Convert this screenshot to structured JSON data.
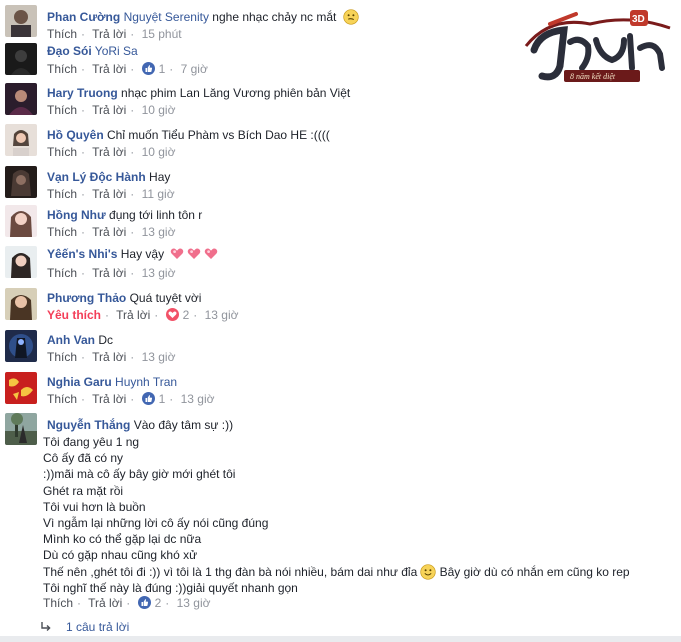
{
  "logo": {
    "title": "Tru Tiên",
    "badge": "3D",
    "tagline": "8 năm kết diệt",
    "icon": "game-logo"
  },
  "actions": {
    "like": "Thích",
    "reply": "Trả lời",
    "liked": "Yêu thích"
  },
  "colors": {
    "author": "#365899",
    "meta": "#90949c",
    "action": "#4b4f56",
    "like_badge": "#4267b2",
    "love_badge": "#f25268",
    "liked_text": "#f33e58"
  },
  "comments": [
    {
      "author": "Phan Cường",
      "mention": "Nguyệt Serenity",
      "text": "nghe nhạc chảy nc mắt",
      "emoji": "smiley-icon",
      "time": "15 phút"
    },
    {
      "author": "Đạo Sói",
      "mention": "",
      "text": "YoRi Sa",
      "reactions": "1",
      "reaction_type": "like",
      "time": "7 giờ"
    },
    {
      "author": "Hary Truong",
      "mention": "",
      "text": "nhạc phim Lan Lăng Vương phiên bản Việt",
      "time": "10 giờ"
    },
    {
      "author": "Hồ Quyên",
      "mention": "",
      "text": "Chỉ muốn Tiểu Phàm vs Bích Dao HE :((((",
      "time": "10 giờ"
    },
    {
      "author": "Vạn Lý Độc Hành",
      "mention": "",
      "text": "Hay",
      "time": "11 giờ"
    },
    {
      "author": "Hồng Như",
      "mention": "",
      "text": "đụng tới linh tôn r",
      "time": "13 giờ"
    },
    {
      "author": "Yêến's Nhi's",
      "mention": "",
      "text": "Hay vậy",
      "hearts": "3",
      "time": "13 giờ"
    },
    {
      "author": "Phương Thảo",
      "mention": "",
      "text": "Quá tuyệt vời",
      "liked": true,
      "reactions": "2",
      "reaction_type": "love",
      "time": "13 giờ"
    },
    {
      "author": "Anh Van",
      "mention": "",
      "text": "Dc",
      "time": "13 giờ"
    },
    {
      "author": "Nghia Garu",
      "mention": "Huynh Tran",
      "text": "",
      "reactions": "1",
      "reaction_type": "like",
      "time": "13 giờ"
    },
    {
      "author": "Nguyễn Thắng",
      "mention": "",
      "text": "Vào đây tâm sự :))",
      "extra_lines": [
        "Tôi đang yêu 1 ng",
        "Cô ấy đã có ny",
        ":))mãi mà cô ấy bây giờ mới ghét tôi",
        "Ghét ra mặt rồi",
        "Tôi vui hơn là buồn",
        "Vì ngẫm lại những lời cô ấy nói cũng đúng",
        "Mình ko có thể gặp lại dc nữa",
        "Dù có gặp nhau cũng khó xử",
        "Thế nên ,ghét tôi đi :)) vì tôi là 1 thg đàn bà nói nhiều, bám dai như đỉa",
        "Tôi nghĩ thế này là đúng :))giải quyết nhanh gọn"
      ],
      "line9_suffix": "Bây giờ dù có nhắn em cũng ko rep",
      "reactions": "2",
      "reaction_type": "like",
      "time": "13 giờ"
    }
  ],
  "replies_link": "1 câu trả lời"
}
